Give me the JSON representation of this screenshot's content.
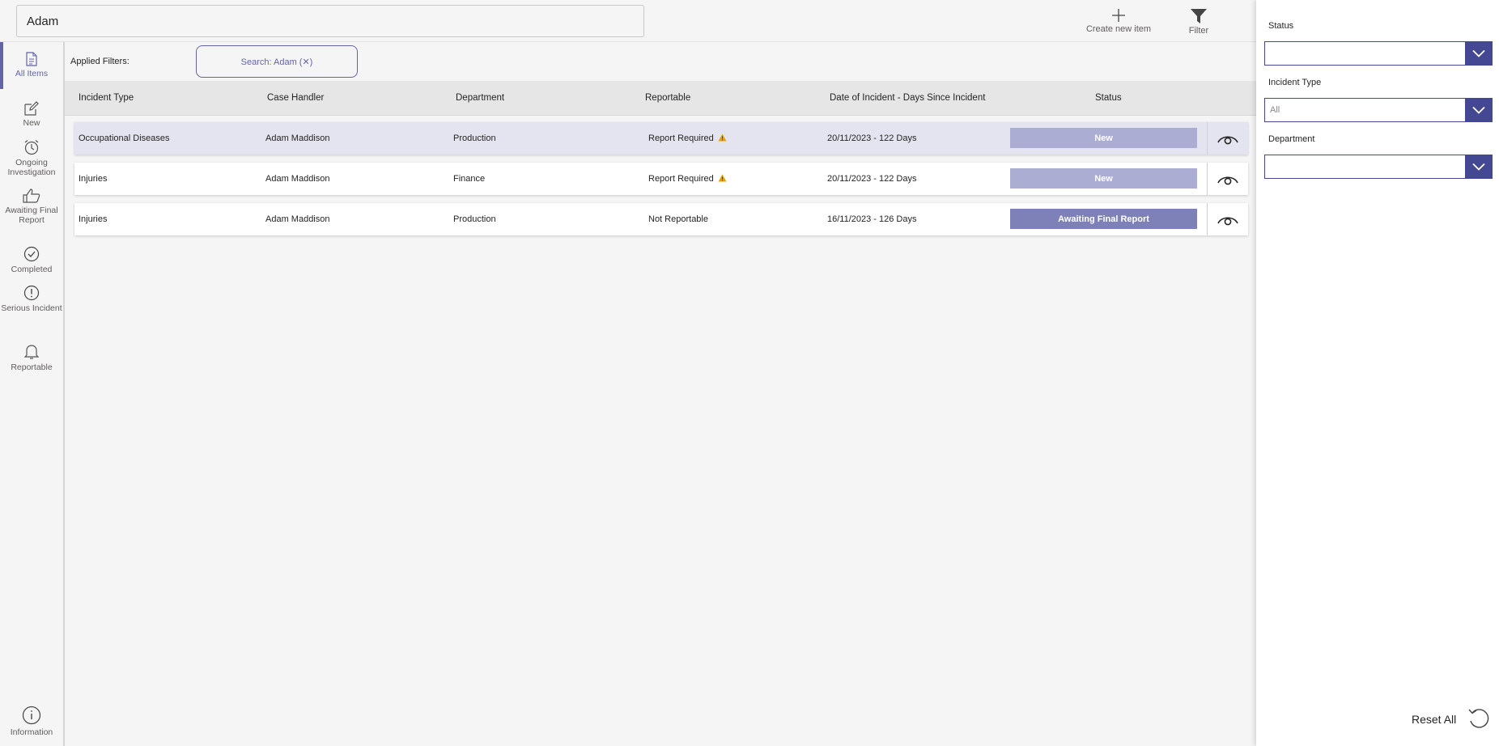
{
  "search": {
    "value": "Adam"
  },
  "actions": {
    "create_label": "Create new item",
    "filter_label": "Filter"
  },
  "nav": {
    "items": [
      {
        "label": "All Items",
        "icon": "document-icon"
      },
      {
        "label": "New",
        "icon": "edit-icon"
      },
      {
        "label": "Ongoing Investigation",
        "icon": "alarm-clock-icon"
      },
      {
        "label": "Awaiting Final Report",
        "icon": "thumbs-up-icon"
      },
      {
        "label": "Completed",
        "icon": "check-circle-icon"
      },
      {
        "label": "Serious Incident",
        "icon": "alert-circle-icon"
      },
      {
        "label": "Reportable",
        "icon": "bell-icon"
      }
    ],
    "info_label": "Information"
  },
  "filters": {
    "applied_label": "Applied Filters:",
    "chip_label": "Search: Adam (✕)"
  },
  "table": {
    "headers": [
      "Incident Type",
      "Case Handler",
      "Department",
      "Reportable",
      "Date of Incident - Days Since Incident",
      "Status"
    ],
    "rows": [
      {
        "incident_type": "Occupational Diseases",
        "case_handler": "Adam Maddison",
        "department": "Production",
        "reportable": "Report Required",
        "warning": true,
        "date": "20/11/2023 - 122 Days",
        "status": "New",
        "status_color": "#acadd3"
      },
      {
        "incident_type": "Injuries",
        "case_handler": "Adam Maddison",
        "department": "Finance",
        "reportable": "Report Required",
        "warning": true,
        "date": "20/11/2023 - 122 Days",
        "status": "New",
        "status_color": "#acadd3"
      },
      {
        "incident_type": "Injuries",
        "case_handler": "Adam Maddison",
        "department": "Production",
        "reportable": "Not Reportable",
        "warning": false,
        "date": "16/11/2023 - 126 Days",
        "status": "Awaiting Final Report",
        "status_color": "#7e80b8"
      }
    ]
  },
  "panel": {
    "status_label": "Status",
    "status_value": "",
    "incident_type_label": "Incident Type",
    "incident_type_value": "All",
    "department_label": "Department",
    "department_value": "",
    "reset_label": "Reset All"
  },
  "colors": {
    "accent": "#6264a7",
    "dropdown": "#444791",
    "warning": "#e8a100"
  }
}
